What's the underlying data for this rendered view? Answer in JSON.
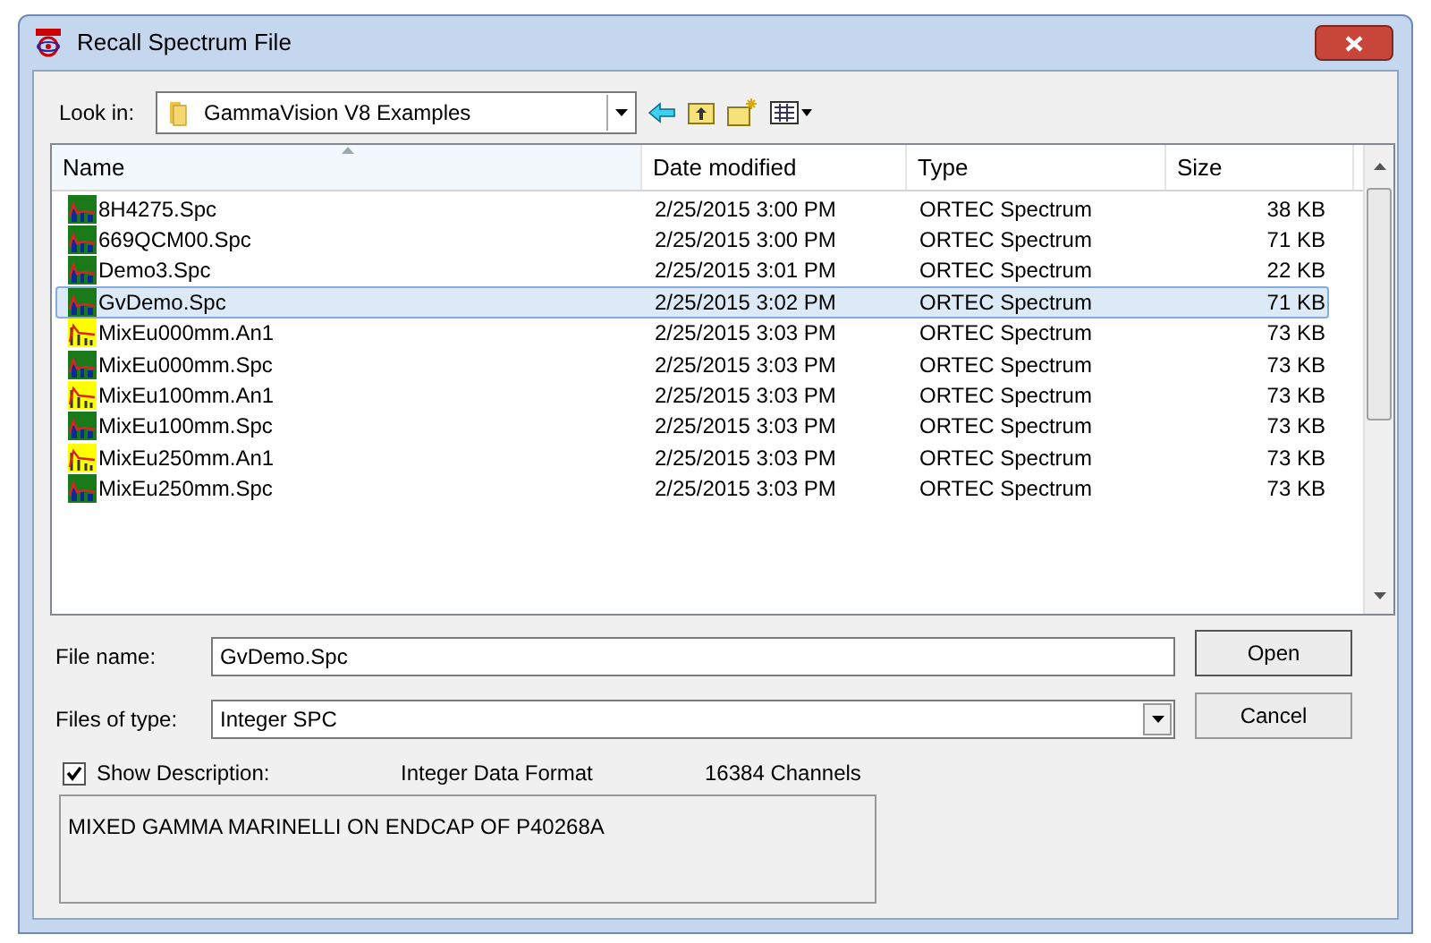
{
  "window": {
    "title": "Recall Spectrum File"
  },
  "look_in": {
    "label": "Look in:",
    "value": "GammaVision V8 Examples"
  },
  "file_list": {
    "columns": [
      {
        "label": "Name",
        "sorted": true
      },
      {
        "label": "Date modified",
        "sorted": false
      },
      {
        "label": "Type",
        "sorted": false
      },
      {
        "label": "Size",
        "sorted": false
      }
    ],
    "rows": [
      {
        "name": "8H4275.Spc",
        "kind": "spc",
        "date": "2/25/2015 3:00 PM",
        "type": "ORTEC Spectrum",
        "size": "38 KB",
        "selected": false
      },
      {
        "name": "669QCM00.Spc",
        "kind": "spc",
        "date": "2/25/2015 3:00 PM",
        "type": "ORTEC Spectrum",
        "size": "71 KB",
        "selected": false
      },
      {
        "name": "Demo3.Spc",
        "kind": "spc",
        "date": "2/25/2015 3:01 PM",
        "type": "ORTEC Spectrum",
        "size": "22 KB",
        "selected": false
      },
      {
        "name": "GvDemo.Spc",
        "kind": "spc",
        "date": "2/25/2015 3:02 PM",
        "type": "ORTEC Spectrum",
        "size": "71 KB",
        "selected": true
      },
      {
        "name": "MixEu000mm.An1",
        "kind": "an1",
        "date": "2/25/2015 3:03 PM",
        "type": "ORTEC Spectrum",
        "size": "73 KB",
        "selected": false
      },
      {
        "name": "MixEu000mm.Spc",
        "kind": "spc",
        "date": "2/25/2015 3:03 PM",
        "type": "ORTEC Spectrum",
        "size": "73 KB",
        "selected": false
      },
      {
        "name": "MixEu100mm.An1",
        "kind": "an1",
        "date": "2/25/2015 3:03 PM",
        "type": "ORTEC Spectrum",
        "size": "73 KB",
        "selected": false
      },
      {
        "name": "MixEu100mm.Spc",
        "kind": "spc",
        "date": "2/25/2015 3:03 PM",
        "type": "ORTEC Spectrum",
        "size": "73 KB",
        "selected": false
      },
      {
        "name": "MixEu250mm.An1",
        "kind": "an1",
        "date": "2/25/2015 3:03 PM",
        "type": "ORTEC Spectrum",
        "size": "73 KB",
        "selected": false
      },
      {
        "name": "MixEu250mm.Spc",
        "kind": "spc",
        "date": "2/25/2015 3:03 PM",
        "type": "ORTEC Spectrum",
        "size": "73 KB",
        "selected": false
      }
    ]
  },
  "file_name": {
    "label": "File name:",
    "value": "GvDemo.Spc"
  },
  "files_of_type": {
    "label": "Files of type:",
    "value": "Integer SPC"
  },
  "buttons": {
    "open": "Open",
    "cancel": "Cancel"
  },
  "show_description": {
    "label": "Show Description:",
    "checked": true,
    "format": "Integer Data Format",
    "channels": "16384 Channels"
  },
  "description": "MIXED GAMMA MARINELLI ON ENDCAP OF P40268A"
}
